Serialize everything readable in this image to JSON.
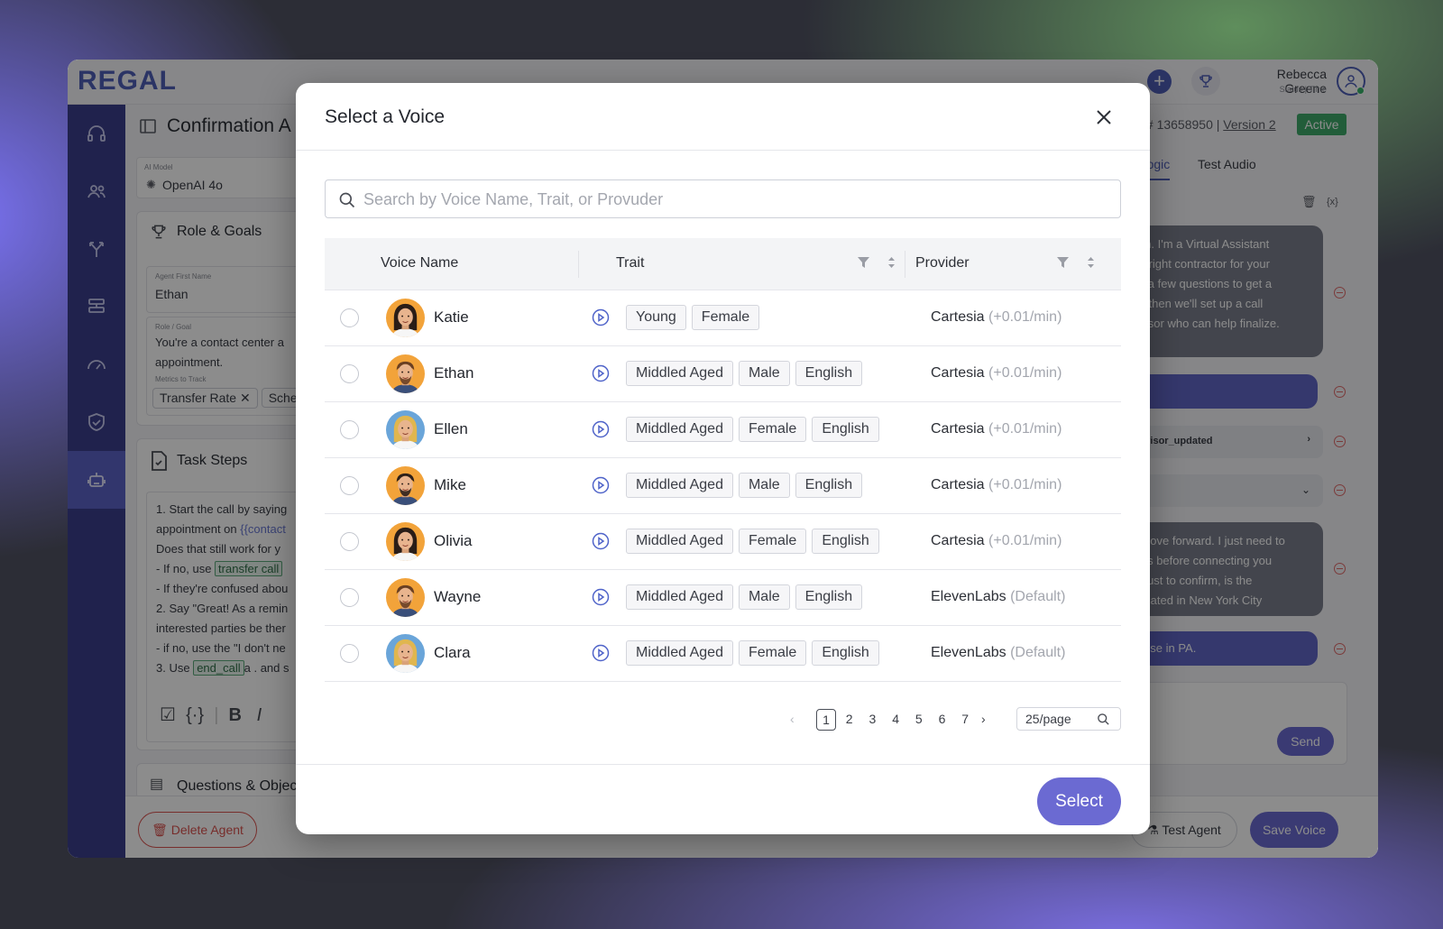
{
  "app": {
    "logo": "REGAL",
    "user_name": "Rebecca Greene",
    "user_status": "Status | Time"
  },
  "background_page": {
    "agent_title": "Confirmation A",
    "id_text": "ID # 13658950 |",
    "version": "Version 2",
    "status_badge": "Active",
    "ai_model_label": "AI Model",
    "ai_model": "OpenAI 4o",
    "role_goals_title": "Role & Goals",
    "agent_first_name_label": "Agent First Name",
    "agent_first_name": "Ethan",
    "role_goal_label": "Role / Goal",
    "role_goal_text_1": "You're a contact center a",
    "role_goal_text_2": "appointment.",
    "metrics_label": "Metrics to Track",
    "metric_1": "Transfer Rate",
    "metric_2": "Sche",
    "task_steps_title": "Task Steps",
    "task_lines": [
      "1.  Start the call by saying",
      "appointment on",
      "{{contact",
      "Does that still work for y",
      "- If no, use",
      "transfer call",
      "- If they're confused abou",
      "2. Say \"Great! As a remin",
      "interested parties be ther",
      "- if no, use the \"I don't ne",
      "3. Use",
      "end_call",
      "a .  and s"
    ],
    "questions_title": "Questions & Objec",
    "delete_agent": "Delete Agent",
    "tab_test_logic": "st Logic",
    "tab_test_audio": "Test Audio",
    "chat_1": "oblem. I'm a Virtual Assistant\nd the right contractor for your\n have a few questions to get a\n, and then we'll set up a call\nt Advisor who can help finalize.",
    "chat_event": "n: advisor_updated",
    "chat_3": "et's move forward. I just need to\ndetails before connecting you\nsor. Just to confirm, is the\nrty located in New York City",
    "chat_4": "'s house in PA.",
    "send": "Send",
    "test_agent": "Test Agent",
    "save_voice": "Save Voice"
  },
  "modal": {
    "title": "Select a Voice",
    "search_placeholder": "Search by Voice Name, Trait, or Provuder",
    "columns": {
      "voice_name": "Voice Name",
      "trait": "Trait",
      "provider": "Provider"
    },
    "voices": [
      {
        "name": "Katie",
        "traits": [
          "Young",
          "Female"
        ],
        "provider": "Cartesia",
        "cost": "(+0.01/min)",
        "face": "f-dark"
      },
      {
        "name": "Ethan",
        "traits": [
          "Middled Aged",
          "Male",
          "English"
        ],
        "provider": "Cartesia",
        "cost": "(+0.01/min)",
        "face": "m-brown"
      },
      {
        "name": "Ellen",
        "traits": [
          "Middled Aged",
          "Female",
          "English"
        ],
        "provider": "Cartesia",
        "cost": "(+0.01/min)",
        "face": "f-blonde"
      },
      {
        "name": "Mike",
        "traits": [
          "Middled Aged",
          "Male",
          "English"
        ],
        "provider": "Cartesia",
        "cost": "(+0.01/min)",
        "face": "m-dark"
      },
      {
        "name": "Olivia",
        "traits": [
          "Middled Aged",
          "Female",
          "English"
        ],
        "provider": "Cartesia",
        "cost": "(+0.01/min)",
        "face": "f-dark"
      },
      {
        "name": "Wayne",
        "traits": [
          "Middled Aged",
          "Male",
          "English"
        ],
        "provider": "ElevenLabs",
        "cost": "(Default)",
        "face": "m-brown"
      },
      {
        "name": "Clara",
        "traits": [
          "Middled Aged",
          "Female",
          "English"
        ],
        "provider": "ElevenLabs",
        "cost": "(Default)",
        "face": "f-blonde"
      }
    ],
    "pagination": {
      "pages": [
        "1",
        "2",
        "3",
        "4",
        "5",
        "6",
        "7"
      ],
      "current": "1",
      "prev": "‹",
      "next": "›",
      "page_size": "25/page"
    },
    "select_button": "Select"
  },
  "colors": {
    "accent": "#6b6ad2",
    "rail": "#3b3f8c",
    "chat_bubble": "#6167c6",
    "active_badge": "#3fa96b",
    "delete": "#d9534f"
  }
}
